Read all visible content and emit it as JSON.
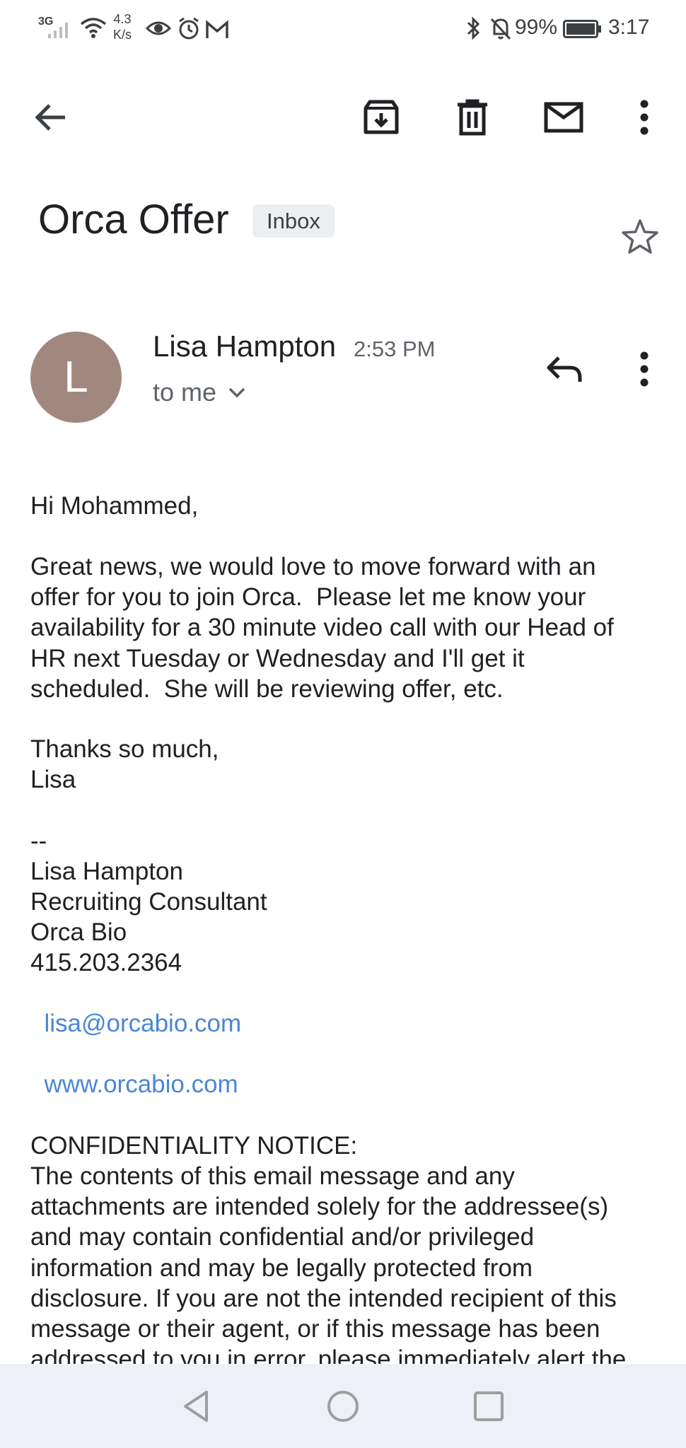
{
  "status_bar": {
    "network_type": "3G",
    "speed_value": "4.3",
    "speed_unit": "K/s",
    "battery_percent": "99%",
    "time": "3:17"
  },
  "toolbar": {
    "back_icon": "arrow-left-icon",
    "archive_icon": "archive-icon",
    "delete_icon": "trash-icon",
    "mark_unread_icon": "mail-icon",
    "more_icon": "more-vertical-icon"
  },
  "email": {
    "subject": "Orca Offer",
    "label": "Inbox",
    "sender_initial": "L",
    "sender_name": "Lisa Hampton",
    "time": "2:53 PM",
    "recipient": "to me",
    "greeting": "Hi Mohammed,",
    "paragraph": "Great news, we would love to move forward with an\noffer for you to join Orca.  Please let me know your\navailability for a 30 minute video call with our Head of\nHR next Tuesday or Wednesday and I'll get it\nscheduled.  She will be reviewing offer, etc.",
    "signoff": "Thanks so much,\nLisa",
    "signature": {
      "separator": "--",
      "name": "Lisa Hampton",
      "title": "Recruiting Consultant",
      "company": "Orca Bio",
      "phone": "415.203.2364",
      "email": "lisa@orcabio.com",
      "website": "www.orcabio.com"
    },
    "notice_heading": "CONFIDENTIALITY NOTICE:",
    "notice_text": "The contents of this email message and any\nattachments are intended solely for the addressee(s)\nand may contain confidential and/or privileged\ninformation and may be legally protected from\ndisclosure. If you are not the intended recipient of this\nmessage or their agent, or if this message has been\naddressed to you in error, please immediately alert the"
  },
  "colors": {
    "avatar_bg": "#a1887f",
    "link": "#4a86d6",
    "chip_bg": "#eceff1",
    "nav_bg": "#eef0f8"
  }
}
